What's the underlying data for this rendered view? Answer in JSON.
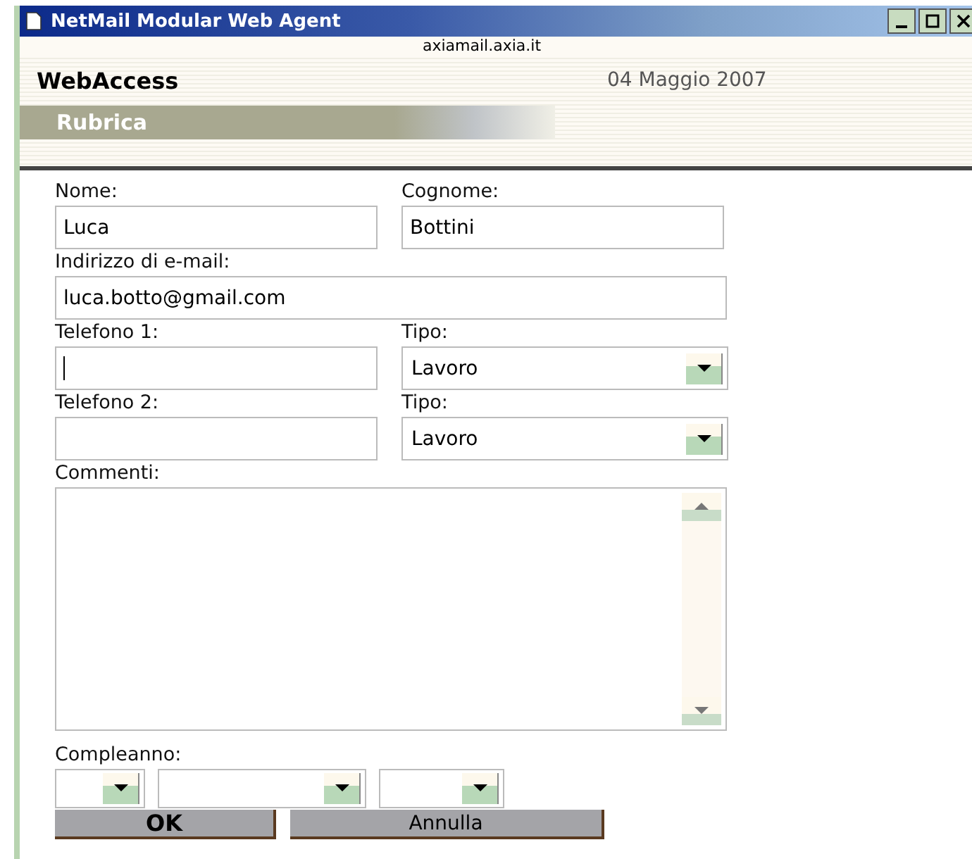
{
  "window": {
    "title": "NetMail Modular Web Agent"
  },
  "address": "axiamail.axia.it",
  "header": {
    "app_name": "WebAccess",
    "date": "04 Maggio 2007",
    "section": "Rubrica"
  },
  "form": {
    "name_row": [
      {
        "label": "Nome:",
        "value": "Luca",
        "focused": false
      },
      {
        "label": "Cognome:",
        "value": "Bottini",
        "focused": false
      }
    ],
    "email": {
      "label": "Indirizzo di e-mail:",
      "value": "luca.botto@gmail.com",
      "focused": false
    },
    "phones": [
      {
        "label": "Telefono 1:",
        "focused": true,
        "type_label": "Tipo:",
        "type_value": "Lavoro"
      },
      {
        "label": "Telefono 2:",
        "focused": false,
        "type_label": "Tipo:",
        "type_value": "Lavoro"
      }
    ],
    "comments": {
      "label": "Commenti:"
    },
    "birthday": {
      "label": "Compleanno:",
      "selects": [
        {
          "kind": "day"
        },
        {
          "kind": "month"
        },
        {
          "kind": "year"
        }
      ]
    },
    "buttons": [
      {
        "label": "OK"
      },
      {
        "label": "Annulla"
      }
    ]
  }
}
